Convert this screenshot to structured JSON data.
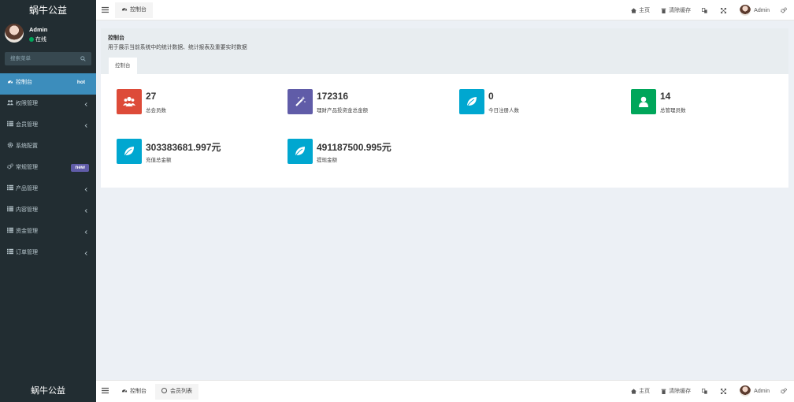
{
  "app": {
    "title": "蜗牛公益"
  },
  "user": {
    "name": "Admin",
    "status": "在线"
  },
  "search": {
    "placeholder": "搜索菜单"
  },
  "sidebar": {
    "items": [
      {
        "label": "控制台",
        "badge": "hot",
        "icon": "dashboard-icon"
      },
      {
        "label": "权限管理",
        "icon": "users-icon"
      },
      {
        "label": "会员管理",
        "icon": "list-icon"
      },
      {
        "label": "系统配置",
        "icon": "gear-icon"
      },
      {
        "label": "常规管理",
        "badge": "new",
        "icon": "gears-icon"
      },
      {
        "label": "产品管理",
        "icon": "list-icon"
      },
      {
        "label": "内容管理",
        "icon": "list-icon"
      },
      {
        "label": "资金管理",
        "icon": "list-icon"
      },
      {
        "label": "订单管理",
        "icon": "list-icon"
      }
    ]
  },
  "topbar": {
    "tab": "控制台",
    "home": "主页",
    "clear_cache": "清除缓存",
    "user": "Admin"
  },
  "content": {
    "title": "控制台",
    "description": "用于展示当前系统中的统计数据、统计报表及重要实时数据",
    "tab": "控制台"
  },
  "stats": [
    {
      "value": "27",
      "label": "总会员数",
      "color": "#dd4b39",
      "icon": "users-icon"
    },
    {
      "value": "172316",
      "label": "理财产品投资金总金额",
      "color": "#605ca8",
      "icon": "magic-icon"
    },
    {
      "value": "0",
      "label": "今日注册人数",
      "color": "#00a7d0",
      "icon": "leaf-icon"
    },
    {
      "value": "14",
      "label": "总管理员数",
      "color": "#00a65a",
      "icon": "user-icon"
    },
    {
      "value": "303383681.997元",
      "label": "充值总金额",
      "color": "#00a7d0",
      "icon": "leaf-icon"
    },
    {
      "value": "491187500.995元",
      "label": "提现金额",
      "color": "#00a7d0",
      "icon": "leaf-icon"
    }
  ],
  "bottombar": {
    "logo": "蜗牛公益",
    "tab1": "控制台",
    "tab2": "会员列表",
    "home": "主页",
    "clear_cache": "清除缓存",
    "user": "Admin"
  }
}
